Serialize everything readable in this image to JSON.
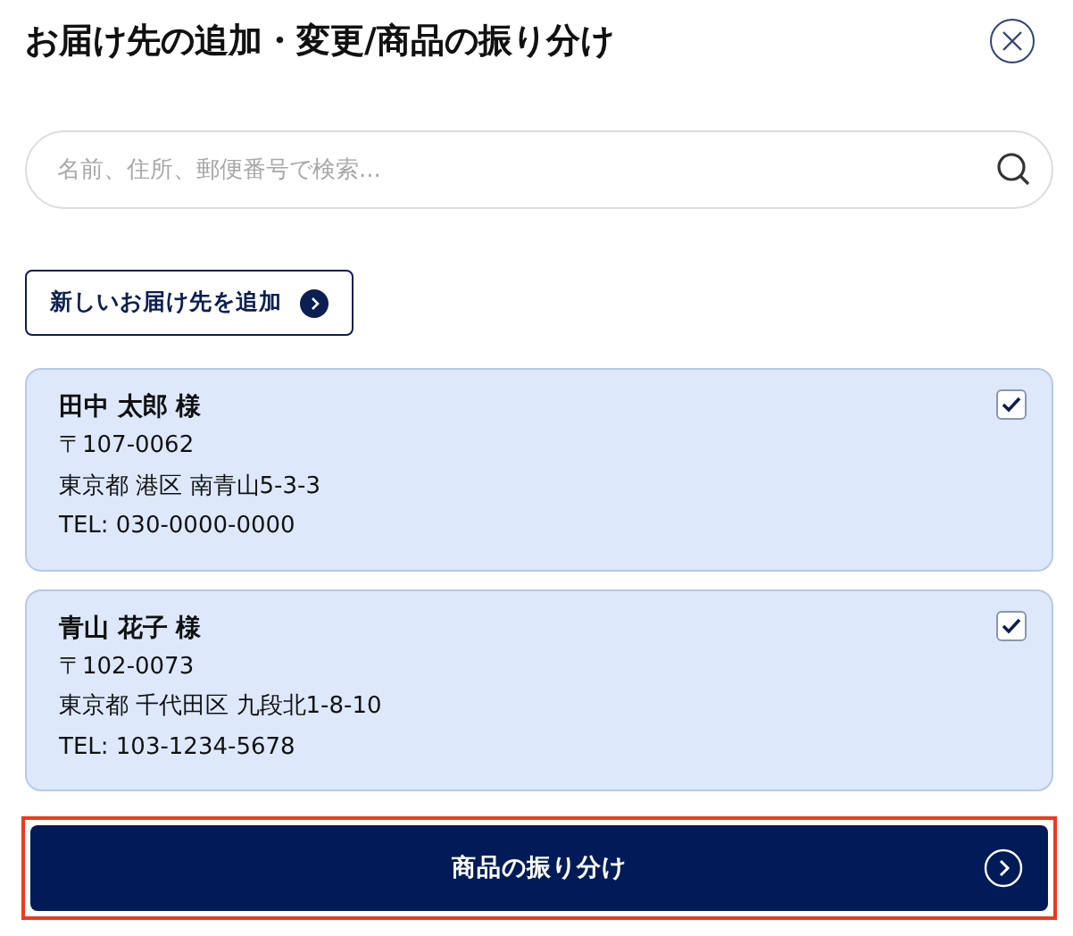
{
  "title": "お届け先の追加・変更/商品の振り分け",
  "search": {
    "placeholder": "名前、住所、郵便番号で検索..."
  },
  "add_button": {
    "label": "新しいお届け先を追加"
  },
  "addresses": [
    {
      "name": "田中 太郎 様",
      "postal": "〒107-0062",
      "address": "東京都 港区 南青山5-3-3",
      "tel": "TEL: 030-0000-0000",
      "checked": true
    },
    {
      "name": "青山 花子 様",
      "postal": "〒102-0073",
      "address": "東京都 千代田区 九段北1-8-10",
      "tel": "TEL: 103-1234-5678",
      "checked": true
    }
  ],
  "submit_button": {
    "label": "商品の振り分け",
    "highlighted": true
  }
}
